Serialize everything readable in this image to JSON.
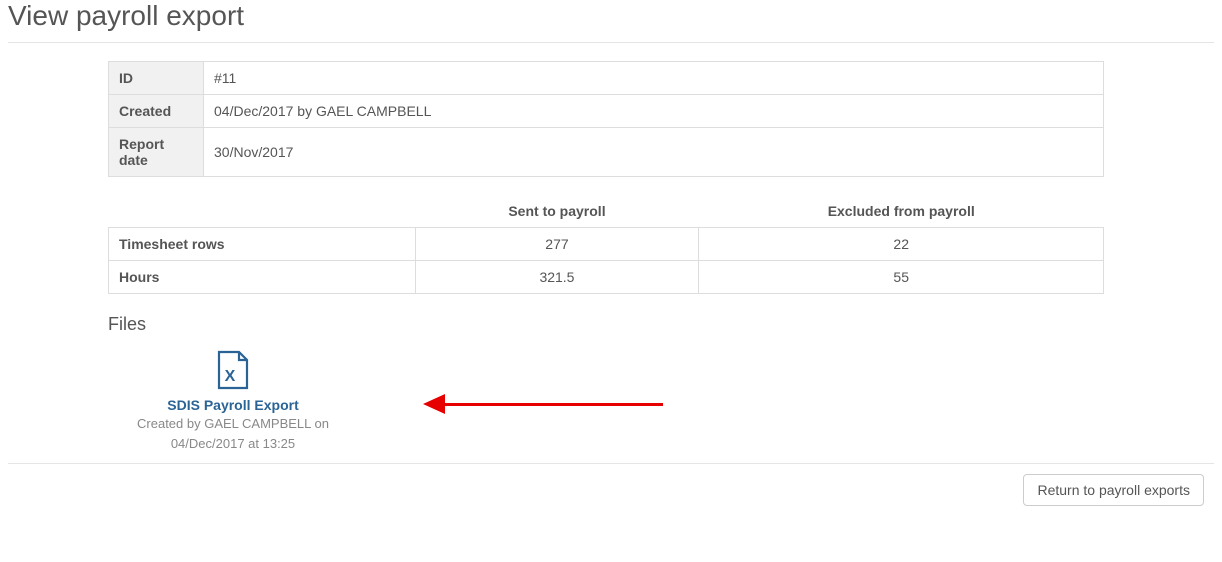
{
  "page": {
    "title": "View payroll export"
  },
  "info": {
    "id_label": "ID",
    "id_value": "#11",
    "created_label": "Created",
    "created_value": "04/Dec/2017 by GAEL CAMPBELL",
    "report_date_label": "Report date",
    "report_date_value": "30/Nov/2017"
  },
  "stats": {
    "col_sent": "Sent to payroll",
    "col_excluded": "Excluded from payroll",
    "row_timesheet_label": "Timesheet rows",
    "row_timesheet_sent": "277",
    "row_timesheet_excluded": "22",
    "row_hours_label": "Hours",
    "row_hours_sent": "321.5",
    "row_hours_excluded": "55"
  },
  "files": {
    "heading": "Files",
    "file_name": "SDIS Payroll Export",
    "file_meta_line1": "Created by GAEL CAMPBELL on",
    "file_meta_line2": "04/Dec/2017 at 13:25"
  },
  "footer": {
    "return_label": "Return to payroll exports"
  }
}
